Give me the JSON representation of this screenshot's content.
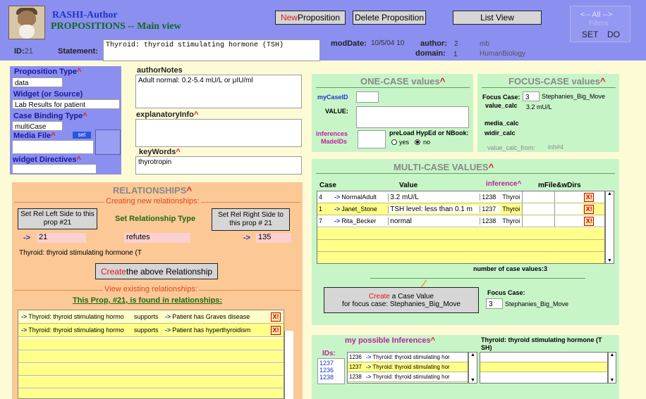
{
  "app": {
    "name": "RASHI-Author",
    "view": "PROPOSITIONS -- Main view"
  },
  "toolbar": {
    "new_prefix": "New",
    "new_rest": " Proposition",
    "delete": "Delete Proposition",
    "list_view": "List View",
    "nav": "<-- All -->",
    "filters": "Filters",
    "set": "SET",
    "do": "DO"
  },
  "prop": {
    "id_label": "ID:",
    "id": "21",
    "statement_label": "Statement:",
    "statement": "Thyroid: thyroid stimulating hormone (TSH)",
    "moddate_label": "modDate:",
    "moddate": "10/5/04 10",
    "author_label": "author:",
    "author_num": "2",
    "author": "mb",
    "domain_label": "domain:",
    "domain_num": "1",
    "domain": "HumanBiology"
  },
  "left": {
    "prop_type_label": "Proposition Type",
    "prop_type": "data",
    "widget_label": "Widget (or Source)",
    "widget": "Lab Results for patient",
    "binding_label": "Case Binding Type",
    "binding": "multiCase",
    "media_label": "Media File",
    "media_set": "set",
    "directives_label": "widget Directives",
    "author_notes_label": "authorNotes",
    "author_notes": "Adult normal: 0.2-5.4 mU/L or μIU/ml",
    "explanatory_label": "explanatoryInfo",
    "keywords_label": "keyWords",
    "keywords": "thyrotropin",
    "caret": "^"
  },
  "relationships": {
    "title": "RELATIONSHIPS",
    "creating": "Creating new relationships:",
    "left_btn": "Set Rel Left Side to this prop #21",
    "type_label": "Set Relationship Type",
    "right_btn": "Set Rel Right Side to this prop # 21",
    "left_val": "21",
    "type_val": "refutes",
    "right_val": "135",
    "left_text": "Thyroid: thyroid stimulating hormone (T",
    "create_prefix": "Create",
    "create_rest": " the above Relationship",
    "view_label": "View existing relationships:",
    "found_text": "This Prop, #21, is found  in relationships:",
    "rows": [
      {
        "left": "Thyroid: thyroid stimulating hormo",
        "type": "supports",
        "right": "Patient has Graves disease"
      },
      {
        "left": "Thyroid: thyroid stimulating hormo",
        "type": "supports",
        "right": "Patient has hyperthyroidism"
      }
    ],
    "x": "X!",
    "arrow": "->"
  },
  "one_case": {
    "title": "ONE-CASE values",
    "my_case_label": "myCaseID",
    "value_label": "VALUE:",
    "inferences_label1": "inferences",
    "inferences_label2": "MadeIDs",
    "preload_label": "preLoad HypEd or NBook:",
    "yes": "yes",
    "no": "no"
  },
  "focus_case": {
    "title": "FOCUS-CASE values",
    "focus_label": "Focus Case:",
    "focus_num": "3",
    "focus_name": "Stephanies_Big_Move",
    "value_calc_label": "value_calc",
    "value_calc": "3.2 mU/L",
    "media_calc_label": "media_calc",
    "widir_calc_label": "widir_calc",
    "from_label": "value_calc_from:",
    "from_val": "inh#4"
  },
  "multi_case": {
    "title": "MULTI-CASE VALUES",
    "col_case": "Case",
    "col_value": "Value",
    "col_inference": "inference^",
    "col_mfile": "mFile&wDirs",
    "rows": [
      {
        "num": "4",
        "name": "NormalAdult",
        "value": "3.2 mU/L",
        "inf": "1238",
        "inf_text": "Thyroi"
      },
      {
        "num": "1",
        "name": "Janet_Stone",
        "value": "TSH level: less than 0.1 m",
        "inf": "1237",
        "inf_text": "Thyroi"
      },
      {
        "num": "7",
        "name": "Rita_Becker",
        "value": "normal",
        "inf": "1238",
        "inf_text": "Thyroi"
      }
    ],
    "count_label": "number of case values:3",
    "create_prefix": "Create",
    "create_rest": " a Case Value",
    "create_line2": "for focus case: Stephanies_Big_Move",
    "focus_label": "Focus Case:",
    "focus_num": "3",
    "focus_name": "Stephanies_Big_Move"
  },
  "inferences": {
    "title": "my possible Inferences",
    "ids_label": "IDs:",
    "ids": [
      "1237",
      "1236",
      "1238"
    ],
    "rows": [
      {
        "id": "1236",
        "text": "Thyroid: thyroid stimulating hor"
      },
      {
        "id": "1237",
        "text": "Thyroid: thyroid stimulating hor"
      },
      {
        "id": "1238",
        "text": "Thyroid: thyroid stimulating hor"
      }
    ],
    "detail_title": "Thyroid: thyroid stimulating hormone (T SH)"
  }
}
